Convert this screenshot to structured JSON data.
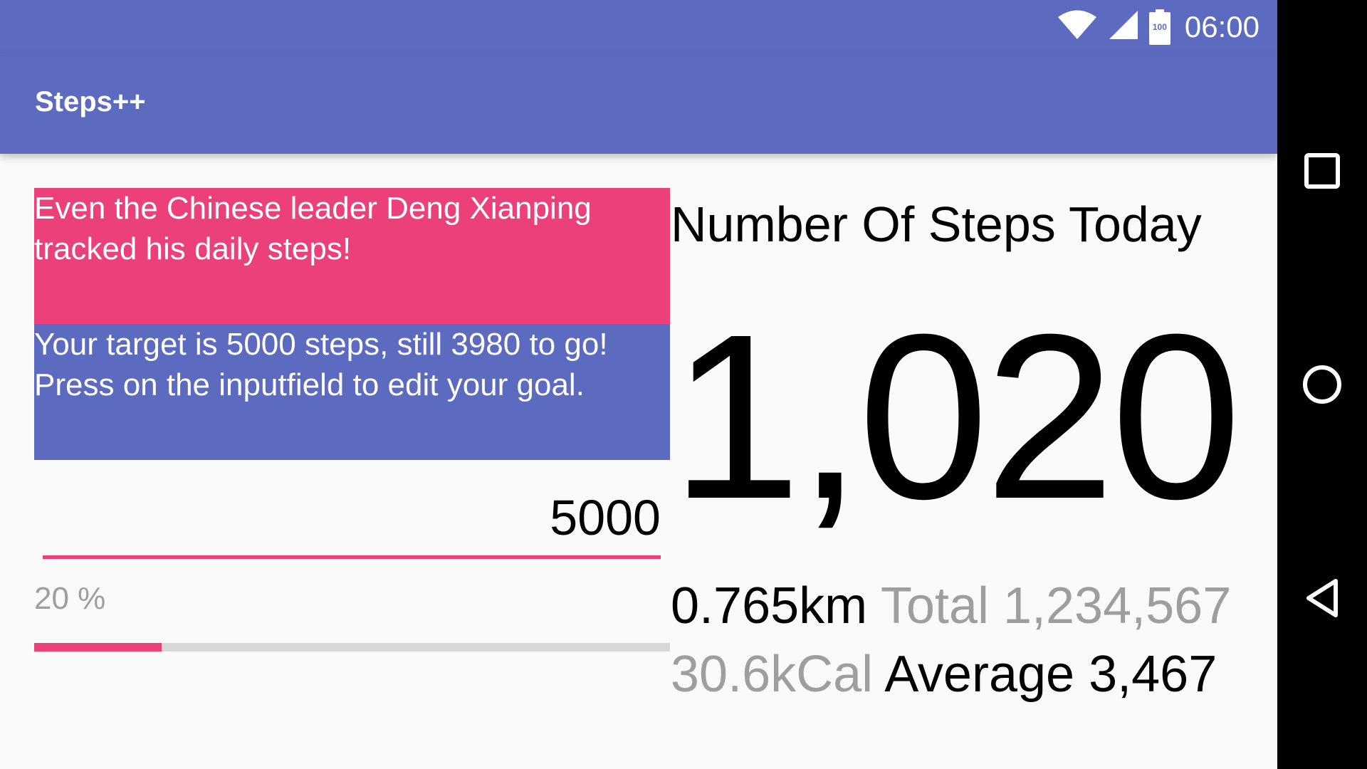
{
  "status_bar": {
    "time": "06:00",
    "battery_level": "100",
    "icons": [
      "wifi-icon",
      "cell-signal-icon",
      "battery-icon"
    ]
  },
  "app_bar": {
    "title": "Steps++"
  },
  "left_panel": {
    "motivation_text": "Even the Chinese leader Deng Xianping tracked his daily steps!",
    "goal_text": "Your target is 5000 steps, still 3980 to go! Press on the inputfield to edit your goal.",
    "goal_input_value": "5000",
    "progress_label": "20 %",
    "progress_fraction": 0.2
  },
  "right_panel": {
    "title": "Number Of Steps Today",
    "steps_today": "1,020",
    "distance": "0.765km",
    "total_label": "Total 1,234,567",
    "calories": "30.6kCal",
    "average_label": "Average 3,467"
  },
  "navigation_bar": {
    "buttons": [
      "recents-icon",
      "home-icon",
      "back-icon"
    ]
  },
  "colors": {
    "primary": "#5c6bc0",
    "accent": "#ec407a",
    "secondary_text": "#9e9e9e",
    "background": "#fafafa"
  }
}
